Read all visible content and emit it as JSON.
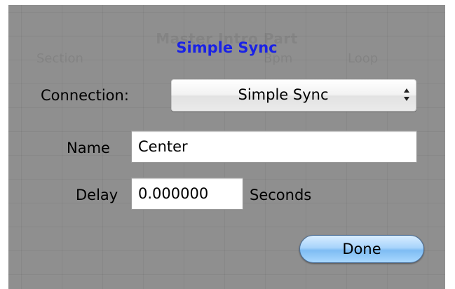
{
  "background_window": {
    "title": "Master Intro Part",
    "columns": [
      "Section",
      "Bpm",
      "Loop"
    ]
  },
  "sheet": {
    "title": "Simple Sync",
    "title_color": "#1a22e6"
  },
  "connection": {
    "label": "Connection:",
    "selected": "Simple Sync",
    "icon": "popup-up-down-arrows-icon"
  },
  "name": {
    "label": "Name",
    "value": "Center"
  },
  "delay": {
    "label": "Delay",
    "value": "0.000000",
    "unit": "Seconds"
  },
  "done_button": {
    "label": "Done",
    "color": "#a8d4fb"
  }
}
